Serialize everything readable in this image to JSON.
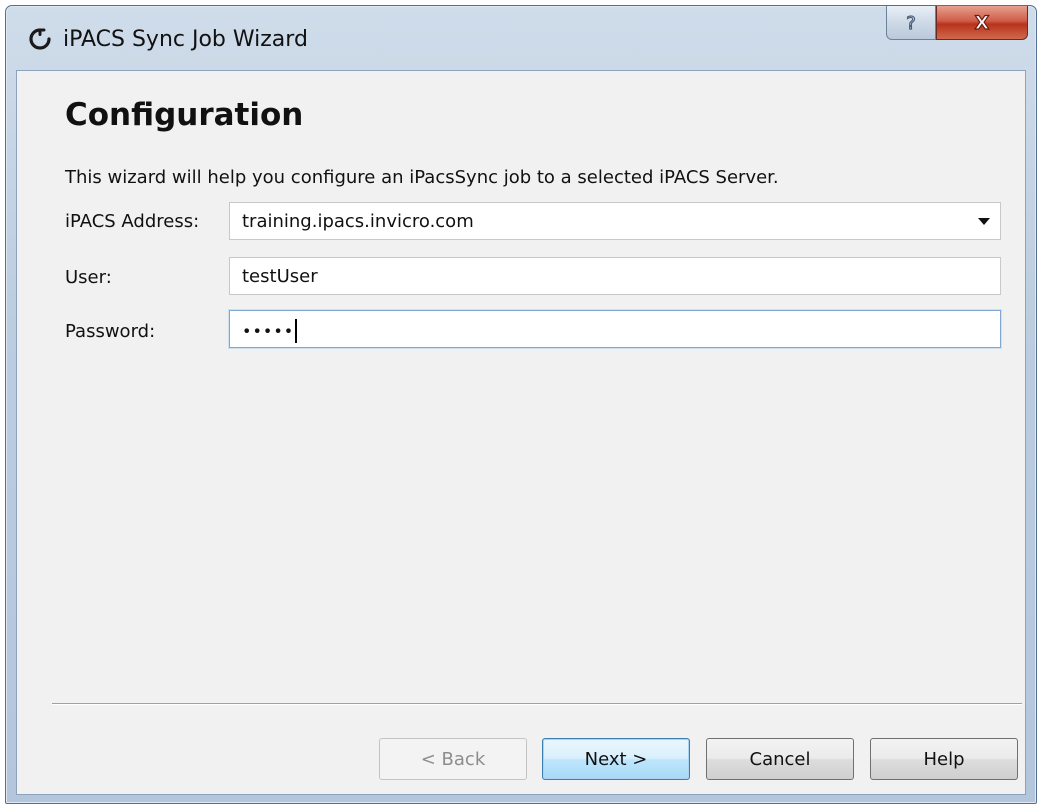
{
  "window": {
    "title": "iPACS Sync Job Wizard",
    "help_glyph": "?",
    "close_glyph": "X"
  },
  "page": {
    "title": "Configuration",
    "description": "This wizard will help you configure an iPacsSync job to a selected iPACS Server."
  },
  "form": {
    "address_label": "iPACS Address:",
    "address_value": "training.ipacs.invicro.com",
    "user_label": "User:",
    "user_value": "testUser",
    "password_label": "Password:",
    "password_value": "•••••"
  },
  "buttons": {
    "back": "< Back",
    "next": "Next >",
    "cancel": "Cancel",
    "help": "Help"
  },
  "colors": {
    "accent": "#3c7fb1",
    "close": "#c0392b"
  },
  "icons": {
    "app": "refresh-icon",
    "help": "question-icon",
    "close": "close-icon",
    "dropdown": "chevron-down-icon"
  }
}
